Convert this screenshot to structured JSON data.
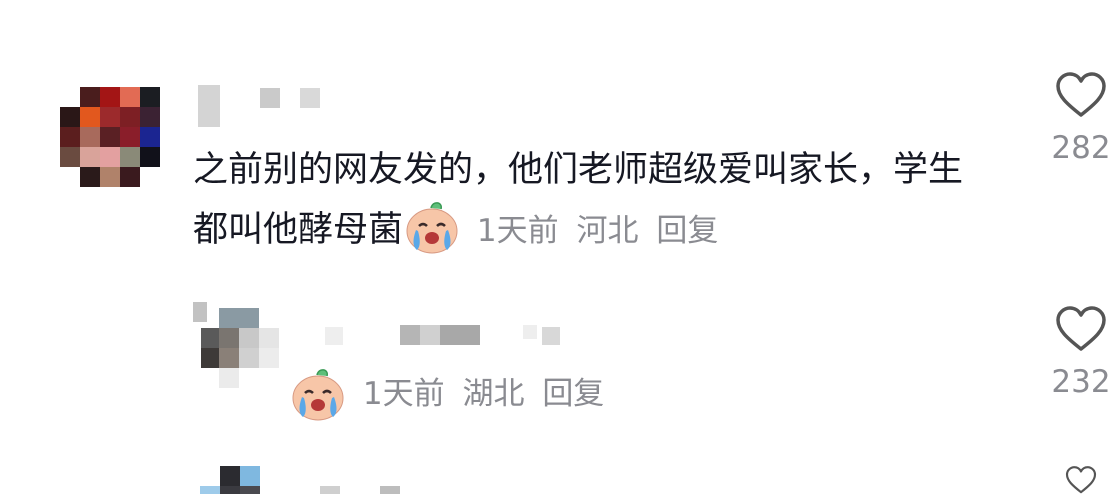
{
  "comments": [
    {
      "text": "之前别的网友发的，他们老师超级爱叫家长，学生都叫他酵母菌",
      "emoji": "crying-face-emoji",
      "time": "1天前",
      "location": "河北",
      "reply": "回复",
      "likes": "282"
    }
  ],
  "replies": [
    {
      "emoji": "crying-face-emoji",
      "time": "1天前",
      "location": "湖北",
      "reply": "回复",
      "likes": "232"
    }
  ],
  "colors": {
    "text": "#161823",
    "meta": "#8a8b91",
    "like_icon": "#555555"
  },
  "icons": {
    "like": "heart-outline-icon"
  }
}
